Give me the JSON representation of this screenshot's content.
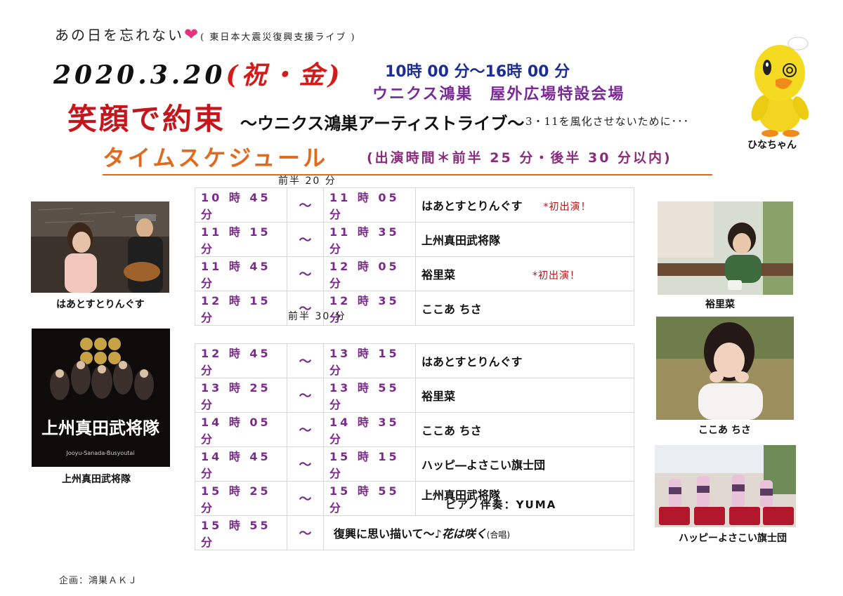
{
  "header": {
    "tagline": "あの日を忘れない",
    "tagline_sub": "( 東日本大震災復興支援ライブ )",
    "date": "2020.3.20",
    "holiday": "(祝・金)",
    "time_range": "10時 00 分～16時 00 分",
    "venue": "ウニクス鴻巣　屋外広場特設会場",
    "title_main": "笑顔で約束",
    "title_sub": "～ウニクス鴻巣アーティストライブ～",
    "title_note": "3・11を風化させないために･･･",
    "schedule_title": "タイムスケジュール",
    "schedule_note": "(出演時間＊前半 25 分・後半 30 分以内)"
  },
  "mascot": {
    "caption": "ひなちゃん",
    "icon": "chick-mascot-icon"
  },
  "schedule": {
    "first_half_label": "前半 20 分",
    "second_half_label": "前半 30 分",
    "tilde": "～",
    "first_half": [
      {
        "start": "10 時 45 分",
        "end": "11 時 05 分",
        "act": "はあとすとりんぐす",
        "note": "*初出演！"
      },
      {
        "start": "11 時 15 分",
        "end": "11 時 35 分",
        "act": "上州真田武将隊",
        "note": ""
      },
      {
        "start": "11 時 45 分",
        "end": "12 時 05 分",
        "act": "裕里菜",
        "note": "*初出演！"
      },
      {
        "start": "12 時 15 分",
        "end": "12 時 35 分",
        "act": "ここあ ちさ",
        "note": ""
      }
    ],
    "second_half": [
      {
        "start": "12 時 45 分",
        "end": "13 時 15 分",
        "act": "はあとすとりんぐす"
      },
      {
        "start": "13 時 25 分",
        "end": "13 時 55 分",
        "act": "裕里菜"
      },
      {
        "start": "14 時 05 分",
        "end": "14 時 35 分",
        "act": "ここあ ちさ"
      },
      {
        "start": "14 時 45 分",
        "end": "15 時 15 分",
        "act": "ハッピ―よさこい旗士団"
      },
      {
        "start": "15 時 25 分",
        "end": "15 時 55 分",
        "act": "上州真田武将隊"
      }
    ],
    "finale": {
      "start": "15 時 55 分",
      "act": "復興に思い描いて～",
      "song": "♪花は咲く",
      "song_note": "(合唱)"
    },
    "piano": "ピアノ伴奏：YUMA"
  },
  "photos": {
    "heart_strings": "はあとすとりんぐす",
    "sanada": "上州真田武将隊",
    "sanada_logo": "上州真田武将隊",
    "sanada_romaji": "Jooyu-Sanada-Busyoutai",
    "yurina": "裕里菜",
    "kokoa": "ここあ ちさ",
    "happy": "ハッピーよさこい旗士団"
  },
  "footer": {
    "organizer": "企画：鴻巣ＡＫＪ"
  },
  "colors": {
    "title_red": "#c4161c",
    "schedule_orange": "#e06a1f",
    "time_purple": "#7b2a8c",
    "venue_purple": "#7a2a94",
    "time_blue": "#1d2e93",
    "heart_pink": "#e4327f"
  }
}
